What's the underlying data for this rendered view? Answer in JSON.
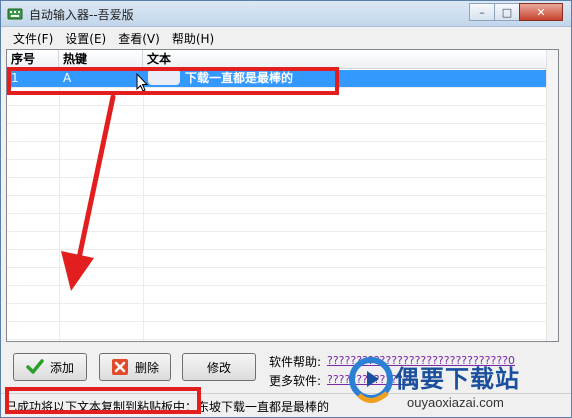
{
  "window": {
    "title": "自动输入器--吾爱版",
    "buttons": {
      "minimize": "–",
      "maximize": "□",
      "close": "✕"
    }
  },
  "menu": [
    {
      "label": "文件(F)"
    },
    {
      "label": "设置(E)"
    },
    {
      "label": "查看(V)"
    },
    {
      "label": "帮助(H)"
    }
  ],
  "list": {
    "columns": [
      "序号",
      "热键",
      "文本"
    ],
    "rows": [
      {
        "index": "1",
        "hotkey": "A",
        "text": "下载一直都是最棒的"
      }
    ]
  },
  "buttons": {
    "add": "添加",
    "delete": "删除",
    "edit": "修改"
  },
  "help": {
    "software_help_label": "软件帮助:",
    "software_help_link": "???????????????????????????????0",
    "more_software_label": "更多软件:",
    "more_software_link": "??????????????"
  },
  "status": {
    "text": "已成功将以下文本复制到粘贴板中：东坡下载一直都是最棒的"
  },
  "watermark": {
    "title": "偶要下载站",
    "domain": "ouyaoxiazai.com"
  },
  "colors": {
    "selection": "#3399ff",
    "annotation": "#e21e1e",
    "link": "#7b2aa8"
  }
}
